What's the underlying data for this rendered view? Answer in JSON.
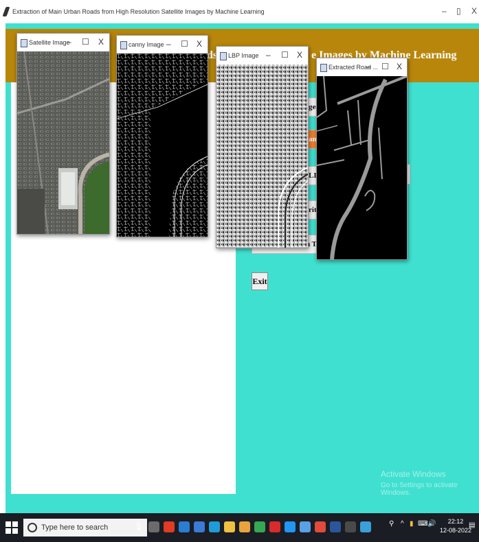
{
  "app": {
    "title": "Extraction of Main Urban Roads from High Resolution Satellite Images by Machine Learning",
    "window_minimize": "–",
    "window_maximize": "▯",
    "window_close": "X",
    "banner_fragment_left": "ads",
    "banner_fragment_right": "e Images by Machine Learning",
    "exit_label": "Exit",
    "partial_buttons": [
      "ges",
      "ani",
      "LI",
      "rit",
      "n T"
    ]
  },
  "windows": [
    {
      "title": "Satellite Image",
      "min": "–",
      "max": "☐",
      "close": "X"
    },
    {
      "title": "canny Image",
      "min": "–",
      "max": "☐",
      "close": "X"
    },
    {
      "title": "LBP Image",
      "min": "–",
      "max": "☐",
      "close": "X"
    },
    {
      "title": "Extracted Road ...",
      "min": "–",
      "max": "☐",
      "close": "X"
    }
  ],
  "watermark": {
    "line1": "Activate Windows",
    "line2": "Go to Settings to activate Windows."
  },
  "taskbar": {
    "search_placeholder": "Type here to search",
    "time": "22:12",
    "date": "12-08-2022",
    "colors": [
      "#6b6b6b",
      "#e03b24",
      "#2b7cd3",
      "#3a7bd5",
      "#1f9bd7",
      "#f0c040",
      "#e8a33d",
      "#34a853",
      "#d92b2b",
      "#2196f3",
      "#5aa0e6",
      "#e24a3b",
      "#2b579a",
      "#4a4a4a",
      "#3aa0d8"
    ]
  }
}
